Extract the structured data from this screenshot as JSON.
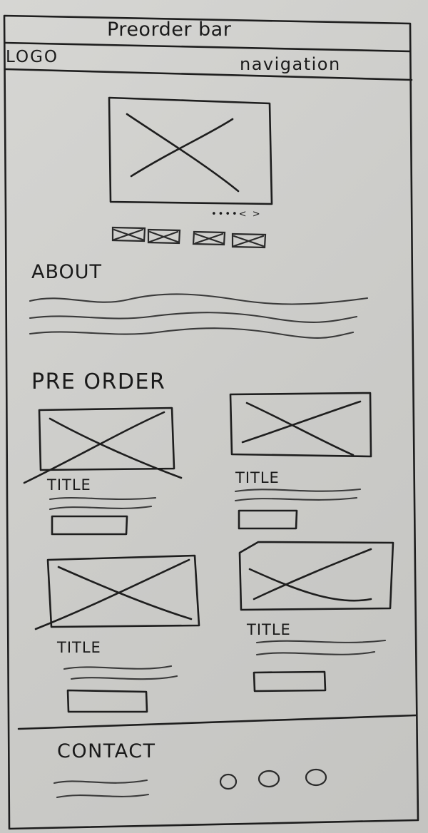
{
  "preorder_bar": {
    "label": "Preorder bar"
  },
  "header": {
    "logo": "LOGO",
    "navigation": "navigation"
  },
  "hero": {
    "carousel_controls": "••••< >"
  },
  "about": {
    "heading": "ABOUT"
  },
  "preorder": {
    "heading": "PRE ORDER",
    "items": [
      {
        "title": "TITLE"
      },
      {
        "title": "TITLE"
      },
      {
        "title": "TITLE"
      },
      {
        "title": "TITLE"
      }
    ]
  },
  "footer": {
    "heading": "CONTACT"
  }
}
